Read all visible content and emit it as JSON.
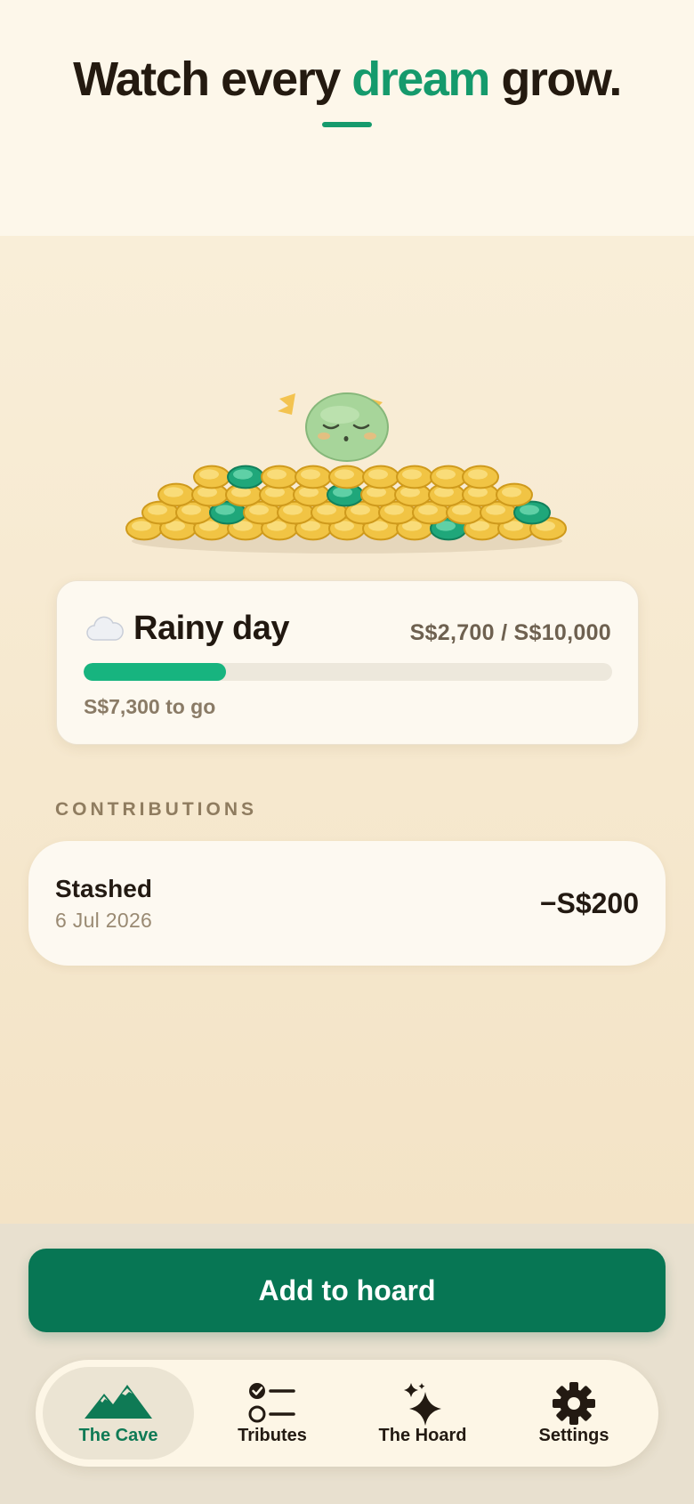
{
  "header": {
    "title_before": "Watch every",
    "title_accent": "dream",
    "title_after": "grow.",
    "accent_color": "#159a6c"
  },
  "goal": {
    "emoji_icon": "cloud-icon",
    "name": "Rainy day",
    "amount": "S$2,700 / S$10,000",
    "progress_fraction": 0.27,
    "remaining": "S$7,300 to go"
  },
  "contributions": {
    "section_label": "CONTRIBUTIONS",
    "items": [
      {
        "title": "Stashed",
        "date": "6 Jul 2026",
        "amount": "−S$200"
      }
    ]
  },
  "actions": {
    "add_label": "Add to hoard",
    "button_color": "#077654"
  },
  "tabbar": {
    "items": [
      {
        "label": "The Cave",
        "icon": "mountains-icon",
        "active": true
      },
      {
        "label": "Tributes",
        "icon": "checklist-icon",
        "active": false
      },
      {
        "label": "The Hoard",
        "icon": "sparkles-icon",
        "active": false
      },
      {
        "label": "Settings",
        "icon": "gear-icon",
        "active": false
      }
    ]
  }
}
